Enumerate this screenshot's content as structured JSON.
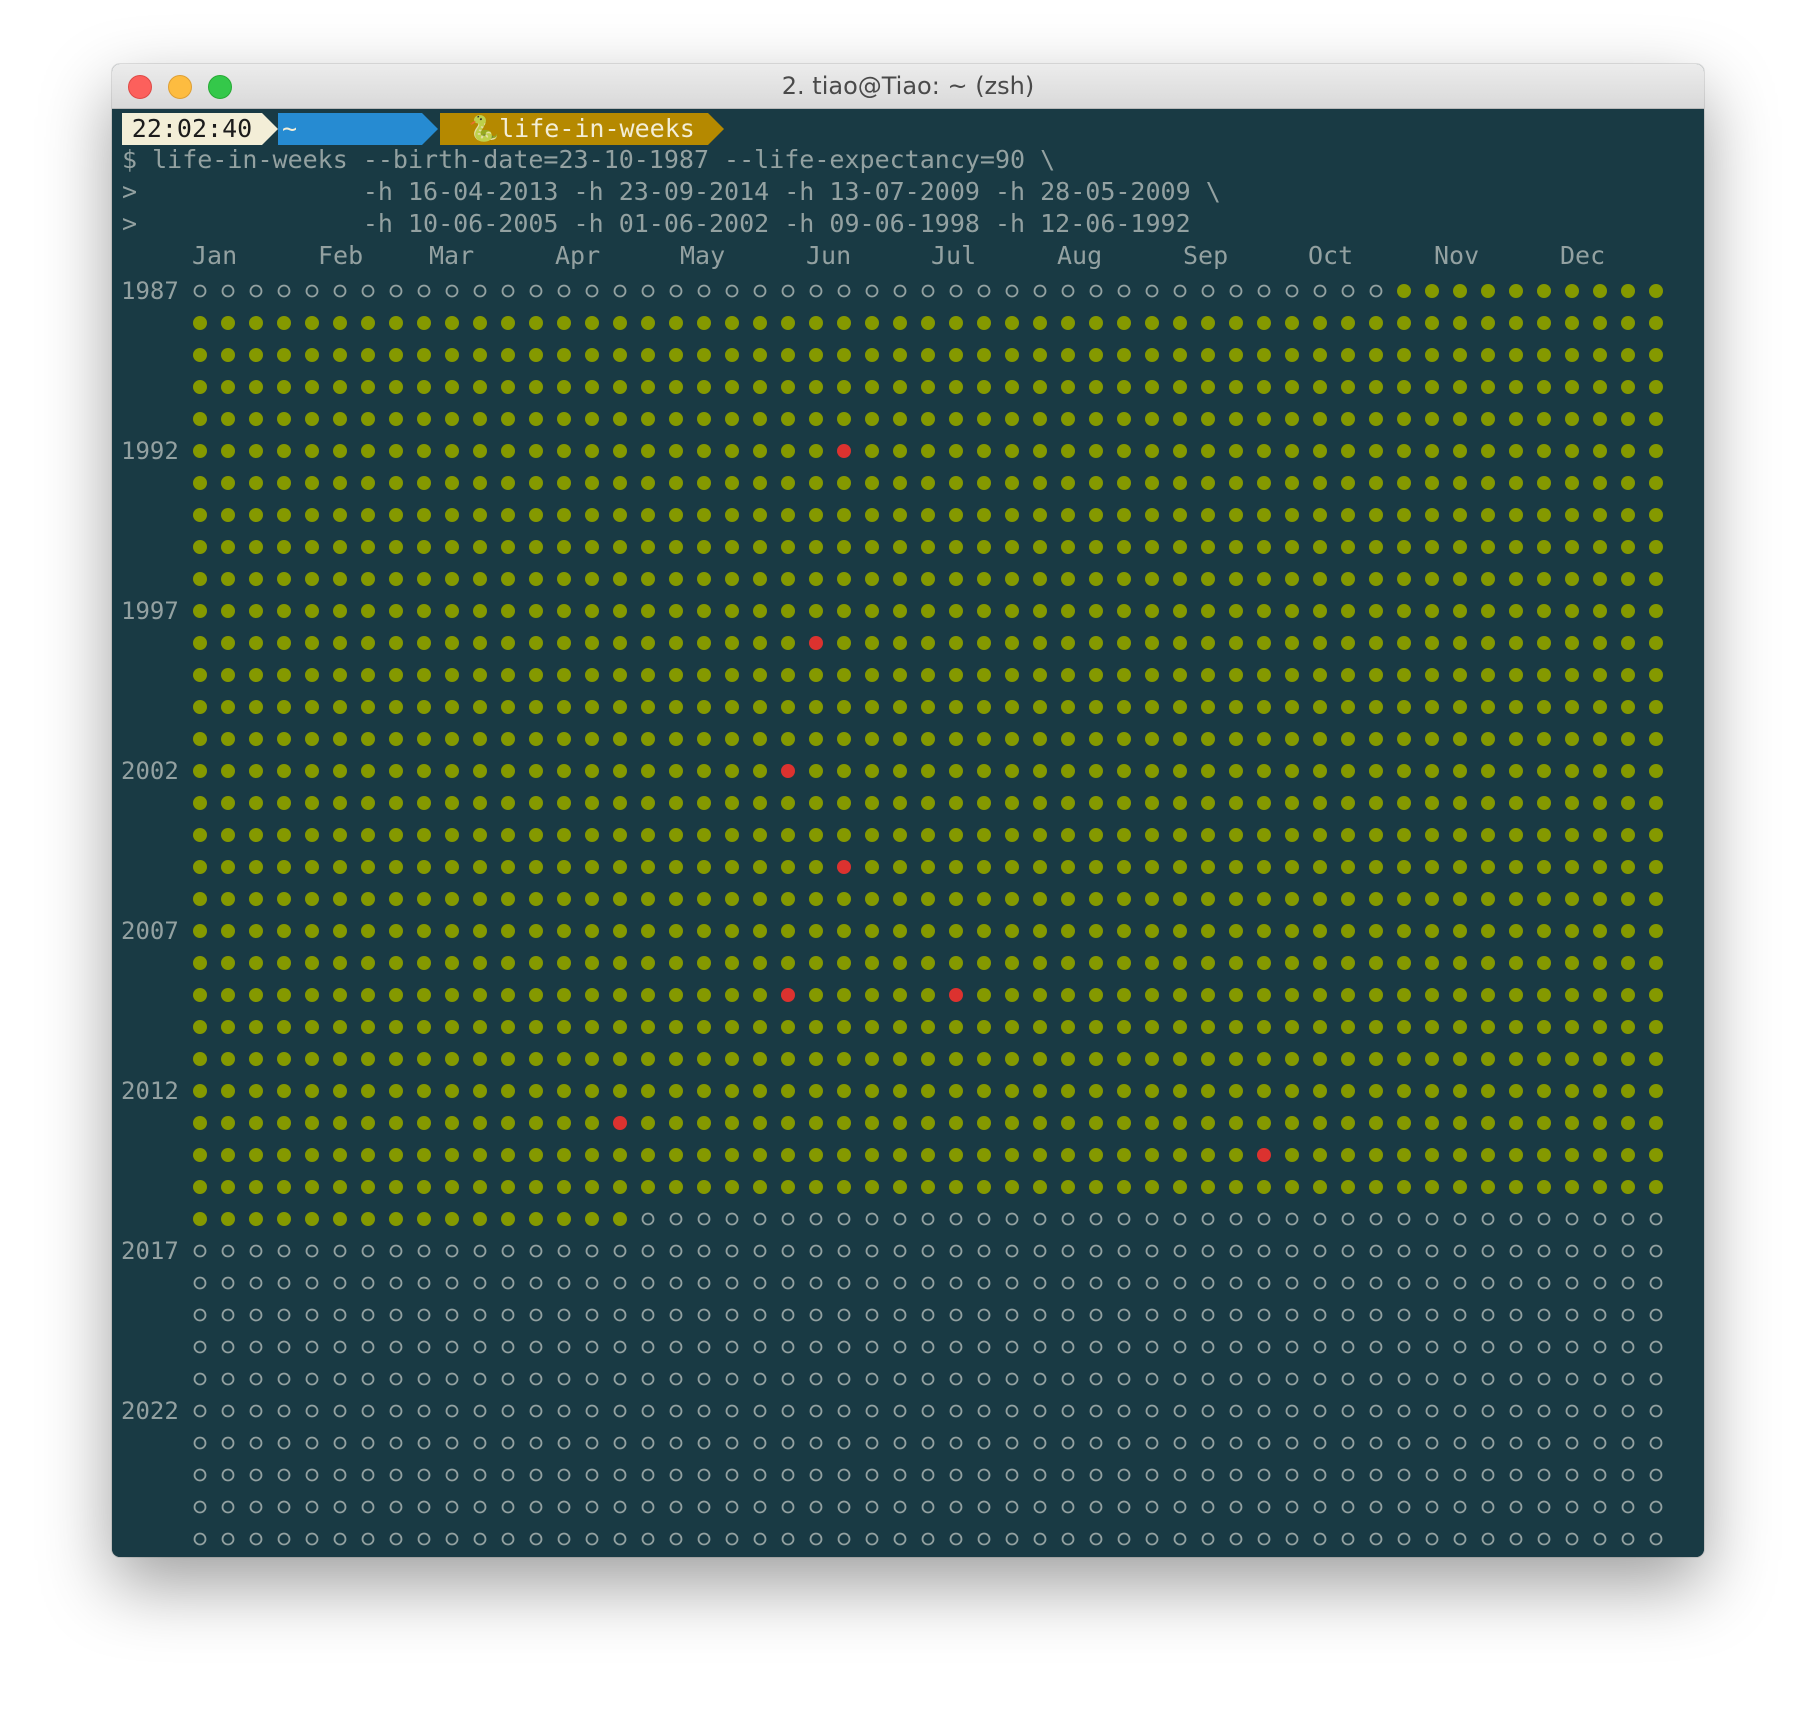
{
  "window": {
    "title": "2. tiao@Tiao: ~ (zsh)"
  },
  "prompt": {
    "time": "22:02:40",
    "home": "~",
    "dir": "🐍life-in-weeks"
  },
  "command": {
    "lines": [
      "$ life-in-weeks --birth-date=23-10-1987 --life-expectancy=90 \\",
      ">               -h 16-04-2013 -h 23-09-2014 -h 13-07-2009 -h 28-05-2009 \\",
      ">               -h 10-06-2005 -h 01-06-2002 -h 09-06-1998 -h 12-06-1992"
    ]
  },
  "months": [
    "Jan",
    "Feb",
    "Mar",
    "Apr",
    "May",
    "Jun",
    "Jul",
    "Aug",
    "Sep",
    "Oct",
    "Nov",
    "Dec"
  ],
  "year_labels": [
    {
      "row": 0,
      "label": "1987"
    },
    {
      "row": 5,
      "label": "1992"
    },
    {
      "row": 10,
      "label": "1997"
    },
    {
      "row": 15,
      "label": "2002"
    },
    {
      "row": 20,
      "label": "2007"
    },
    {
      "row": 25,
      "label": "2012"
    },
    {
      "row": 30,
      "label": "2017"
    },
    {
      "row": 35,
      "label": "2022"
    }
  ],
  "grid": {
    "visible_rows": 40,
    "weeks_per_row": 53,
    "lived_from": {
      "row": 0,
      "week": 43
    },
    "lived_until": {
      "row": 29,
      "week": 15
    },
    "highlights": [
      {
        "row": 5,
        "week": 23
      },
      {
        "row": 11,
        "week": 22
      },
      {
        "row": 15,
        "week": 21
      },
      {
        "row": 18,
        "week": 23
      },
      {
        "row": 22,
        "week": 21
      },
      {
        "row": 22,
        "week": 27
      },
      {
        "row": 26,
        "week": 15
      },
      {
        "row": 27,
        "week": 38
      }
    ]
  },
  "colors": {
    "background": "#193a44",
    "lived": "#859900",
    "future": "#93a1a1",
    "highlight": "#dc322f",
    "text": "#93a1a1"
  }
}
